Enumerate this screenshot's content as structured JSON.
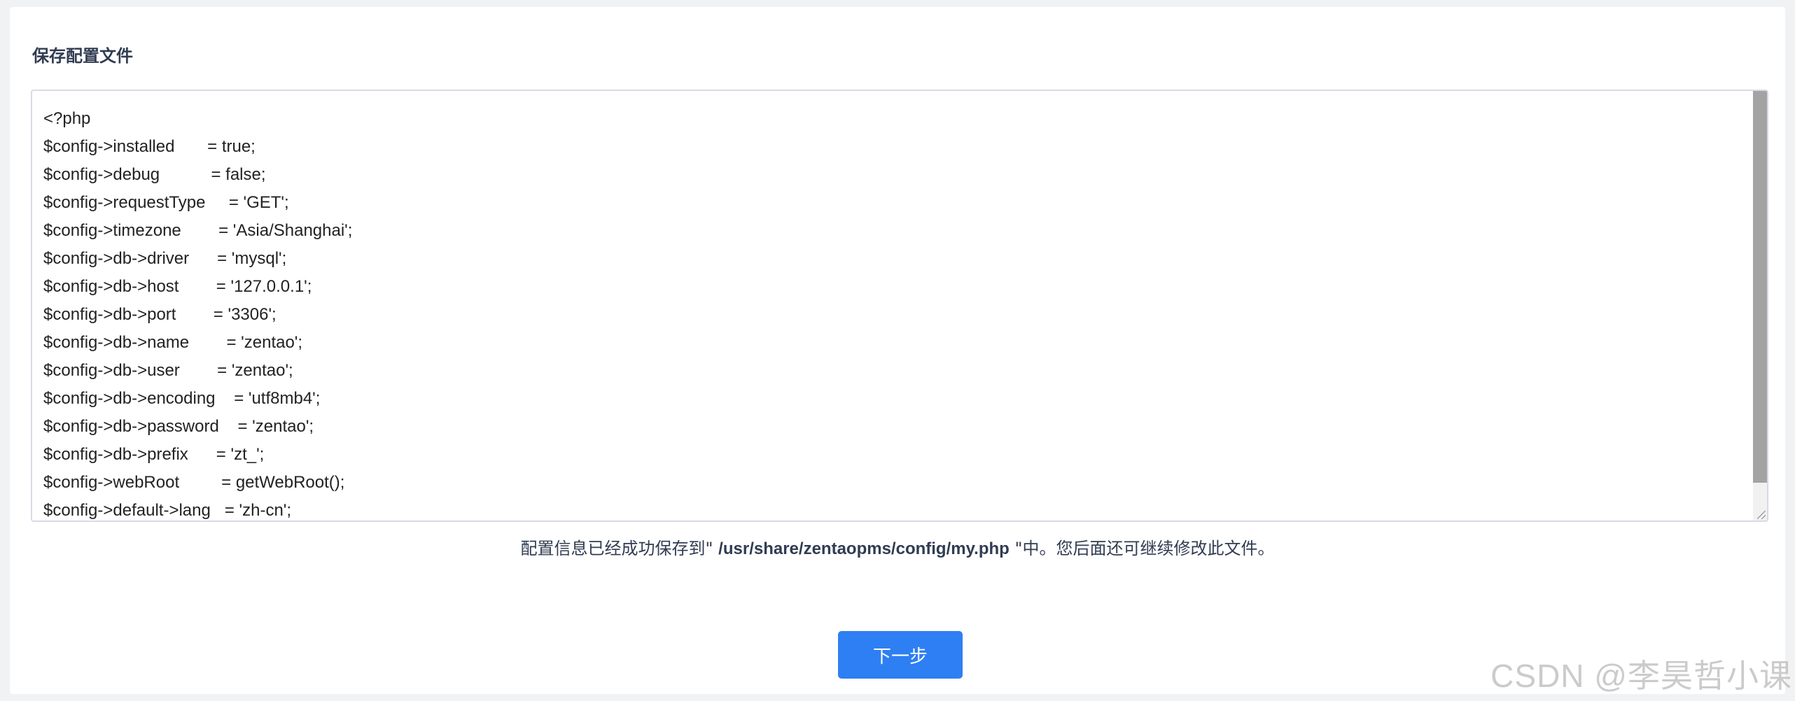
{
  "panel": {
    "title": "保存配置文件"
  },
  "config": {
    "content": "<?php\n$config->installed       = true;\n$config->debug           = false;\n$config->requestType     = 'GET';\n$config->timezone        = 'Asia/Shanghai';\n$config->db->driver      = 'mysql';\n$config->db->host        = '127.0.0.1';\n$config->db->port        = '3306';\n$config->db->name        = 'zentao';\n$config->db->user        = 'zentao';\n$config->db->encoding    = 'utf8mb4';\n$config->db->password    = 'zentao';\n$config->db->prefix      = 'zt_';\n$config->webRoot         = getWebRoot();\n$config->default->lang   = 'zh-cn';"
  },
  "message": {
    "prefix": "配置信息已经成功保存到\" ",
    "path": "/usr/share/zentaopms/config/my.php",
    "suffix": " \"中。您后面还可继续修改此文件。"
  },
  "actions": {
    "next_label": "下一步"
  },
  "watermark": {
    "text": "CSDN @李昊哲小课"
  },
  "colors": {
    "primary": "#2e7ff3",
    "text": "#313c52",
    "border": "#d7dae8",
    "background": "#f1f2f4"
  }
}
